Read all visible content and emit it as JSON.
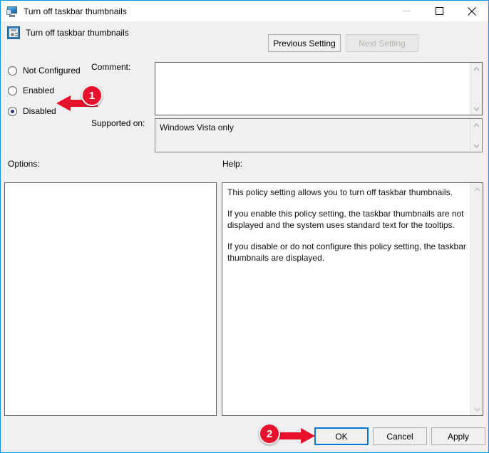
{
  "window": {
    "title": "Turn off taskbar thumbnails",
    "icon": "computer-monitor-icon",
    "controls": {
      "minimize_label": "Minimize",
      "maximize_label": "Maximize",
      "close_label": "Close"
    }
  },
  "header": {
    "title": "Turn off taskbar thumbnails",
    "icon": "policy-setting-icon",
    "previous_setting_label": "Previous Setting",
    "next_setting_label": "Next Setting",
    "next_setting_disabled": true
  },
  "state_options": [
    {
      "label": "Not Configured",
      "selected": false
    },
    {
      "label": "Enabled",
      "selected": false
    },
    {
      "label": "Disabled",
      "selected": true
    }
  ],
  "comment": {
    "label": "Comment:",
    "value": "",
    "placeholder": ""
  },
  "supported_on": {
    "label": "Supported on:",
    "value": "Windows Vista only"
  },
  "options": {
    "label": "Options:",
    "content": ""
  },
  "help": {
    "label": "Help:",
    "paragraphs": [
      "This policy setting allows you to turn off taskbar thumbnails.",
      "If you enable this policy setting, the taskbar thumbnails are not displayed and the system uses standard text for the tooltips.",
      "If you disable or do not configure this policy setting, the taskbar thumbnails are displayed."
    ]
  },
  "footer": {
    "ok_label": "OK",
    "cancel_label": "Cancel",
    "apply_label": "Apply"
  },
  "annotations": [
    {
      "number": "1",
      "points_to": "Disabled radio button"
    },
    {
      "number": "2",
      "points_to": "OK button"
    }
  ],
  "colors": {
    "accent": "#0078d7",
    "window_border": "#0099e5",
    "annotation_red": "#e8112d",
    "body_background": "#f0f0f0"
  }
}
